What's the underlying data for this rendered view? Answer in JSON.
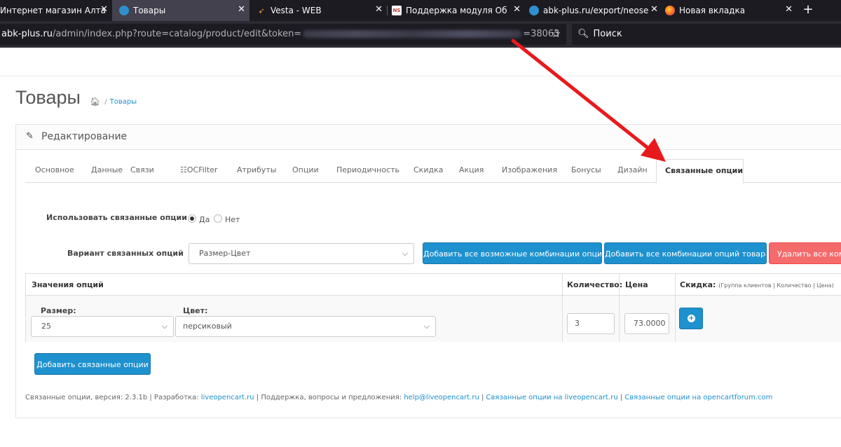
{
  "browser": {
    "tabs": [
      {
        "title": "Интернет магазин Алта",
        "favicon": "generic-favicon",
        "active": false
      },
      {
        "title": "Товары",
        "favicon": "opencart-favicon",
        "active": true
      },
      {
        "title": "Vesta - WEB",
        "favicon": "vesta-favicon",
        "active": false
      },
      {
        "title": "Поддержка модуля Об",
        "favicon": "ns-favicon",
        "active": false
      },
      {
        "title": "abk-plus.ru/export/neose",
        "favicon": "opencart-favicon",
        "active": false
      },
      {
        "title": "Новая вкладка",
        "favicon": "firefox-favicon",
        "active": false
      }
    ],
    "new_tab_icon": "plus-icon",
    "url": {
      "host": "abk-plus.ru",
      "path": "/admin/index.php?route=catalog/product/edit&token=",
      "suffix": "=38063"
    },
    "search_placeholder": "Поиск"
  },
  "page": {
    "title": "Товары",
    "breadcrumb": {
      "home_icon": "home-icon",
      "separator": "/",
      "current": "Товары"
    },
    "panel_title": "Редактирование",
    "tabs": [
      "Основное",
      "Данные",
      "Связи",
      "OCFilter",
      "Атрибуты",
      "Опции",
      "Периодичность",
      "Скидка",
      "Акция",
      "Изображения",
      "Бонусы",
      "Дизайн",
      "Связанные опции"
    ],
    "active_tab": "Связанные опции"
  },
  "related_options": {
    "use_label": "Использовать связанные опции",
    "use_yes": "Да",
    "use_no": "Нет",
    "use_value": "Да",
    "variant_label": "Вариант связанных опций",
    "variant_value": "Размер-Цвет",
    "btn_add_all_possible": "Добавить все возможные комбинации опций",
    "btn_add_all_product": "Добавить все комбинации опций товара",
    "btn_delete_all": "Удалить все комбинации",
    "table": {
      "col_values": "Значения опций",
      "col_quantity": "Количество:",
      "col_price": "Цена",
      "col_discount": "Скидка:",
      "col_discount_note": "(Группа клиентов | Количество | Цена)",
      "row": {
        "size_label": "Размер:",
        "size_value": "25",
        "color_label": "Цвет:",
        "color_value": "персиковый",
        "quantity": "3",
        "price": "73.0000"
      }
    },
    "btn_add_related": "Добавить связанные опции",
    "footer": {
      "prefix": "Связанные опции, версия: 2.3.1b | Разработка: ",
      "dev_link": "liveopencart.ru",
      "support_text": " | Поддержка, вопросы и предложения: ",
      "email": "help@liveopencart.ru",
      "sep1": " | ",
      "link1": "Связанные опции на liveopencart.ru",
      "sep2": " | ",
      "link2": "Связанные опции на opencartforum.com"
    }
  },
  "annotation": {
    "color": "#e8191c"
  }
}
